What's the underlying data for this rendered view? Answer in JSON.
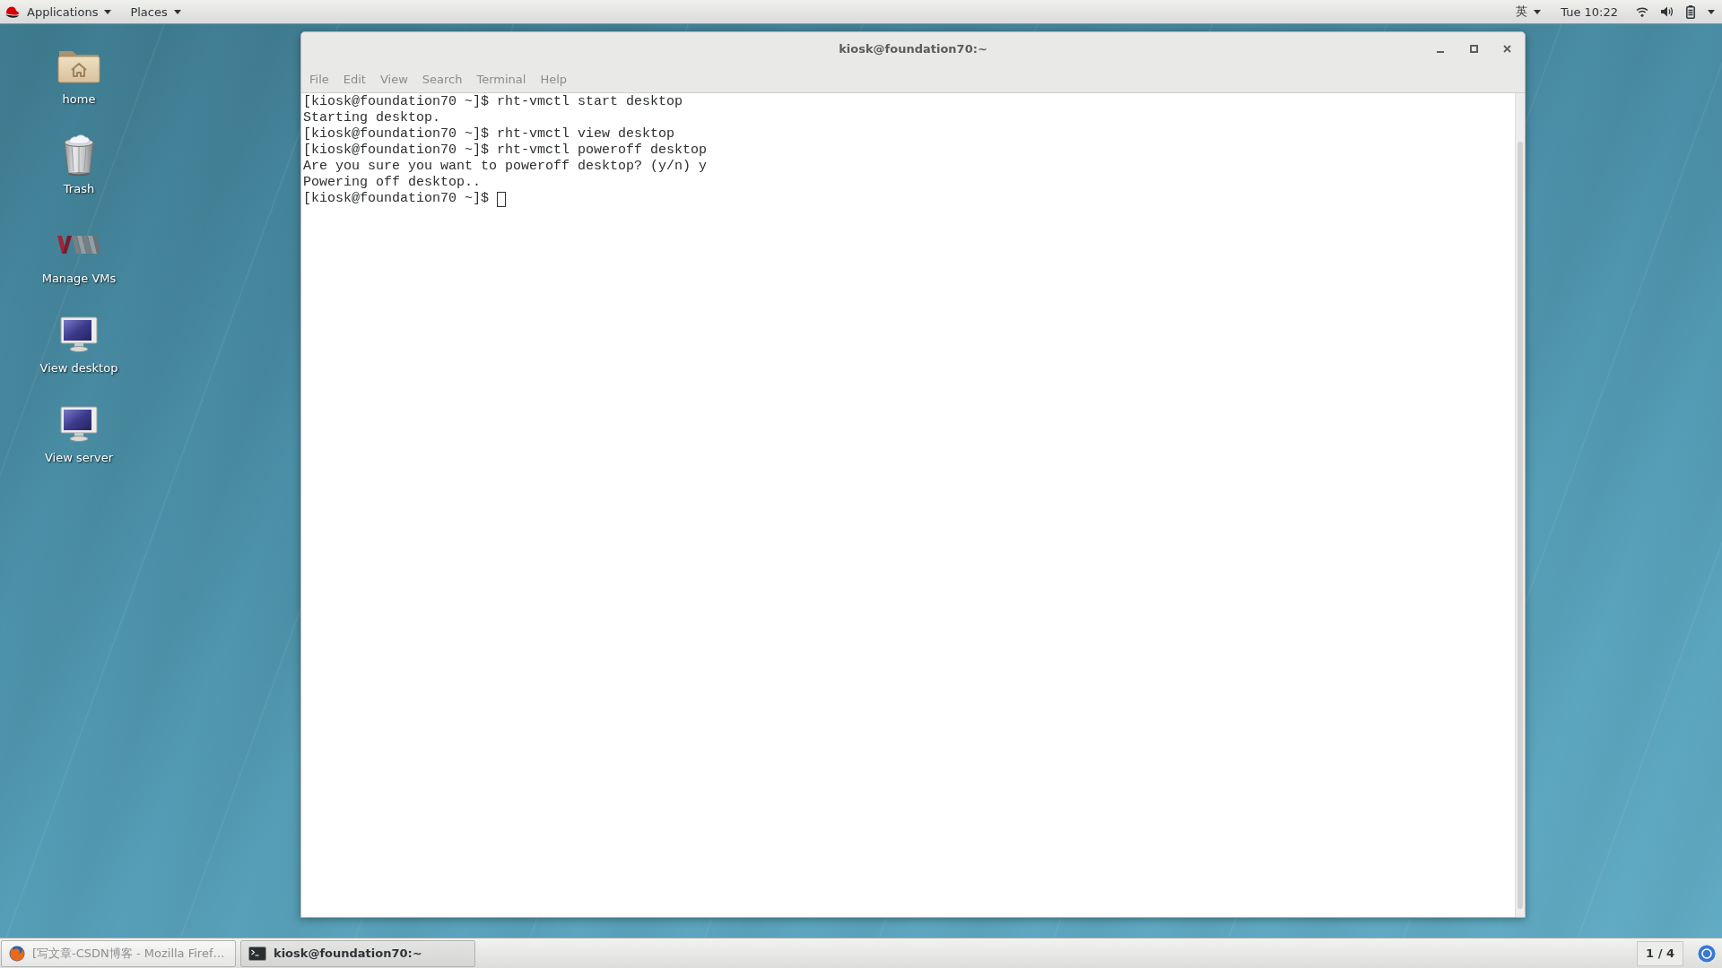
{
  "top_bar": {
    "menus": [
      {
        "label": "Applications"
      },
      {
        "label": "Places"
      }
    ],
    "input_method": "英",
    "clock": "Tue 10:22"
  },
  "desktop_icons": [
    {
      "label": "home",
      "kind": "folder"
    },
    {
      "label": "Trash",
      "kind": "trash"
    },
    {
      "label": "Manage VMs",
      "kind": "vm"
    },
    {
      "label": "View desktop",
      "kind": "monitor"
    },
    {
      "label": "View server",
      "kind": "monitor"
    }
  ],
  "terminal": {
    "title": "kiosk@foundation70:~",
    "menu": [
      "File",
      "Edit",
      "View",
      "Search",
      "Terminal",
      "Help"
    ],
    "lines": [
      "[kiosk@foundation70 ~]$ rht-vmctl start desktop",
      "Starting desktop.",
      "[kiosk@foundation70 ~]$ rht-vmctl view desktop",
      "[kiosk@foundation70 ~]$ rht-vmctl poweroff desktop",
      "Are you sure you want to poweroff desktop? (y/n) y",
      "Powering off desktop..",
      "[kiosk@foundation70 ~]$"
    ],
    "cursor": true
  },
  "taskbar": {
    "windows": [
      {
        "label": "[写文章-CSDN博客 - Mozilla Firef…",
        "kind": "browser",
        "selected": false
      },
      {
        "label": "kiosk@foundation70:~",
        "kind": "terminal",
        "selected": true
      }
    ],
    "workspace": "1 / 4"
  }
}
